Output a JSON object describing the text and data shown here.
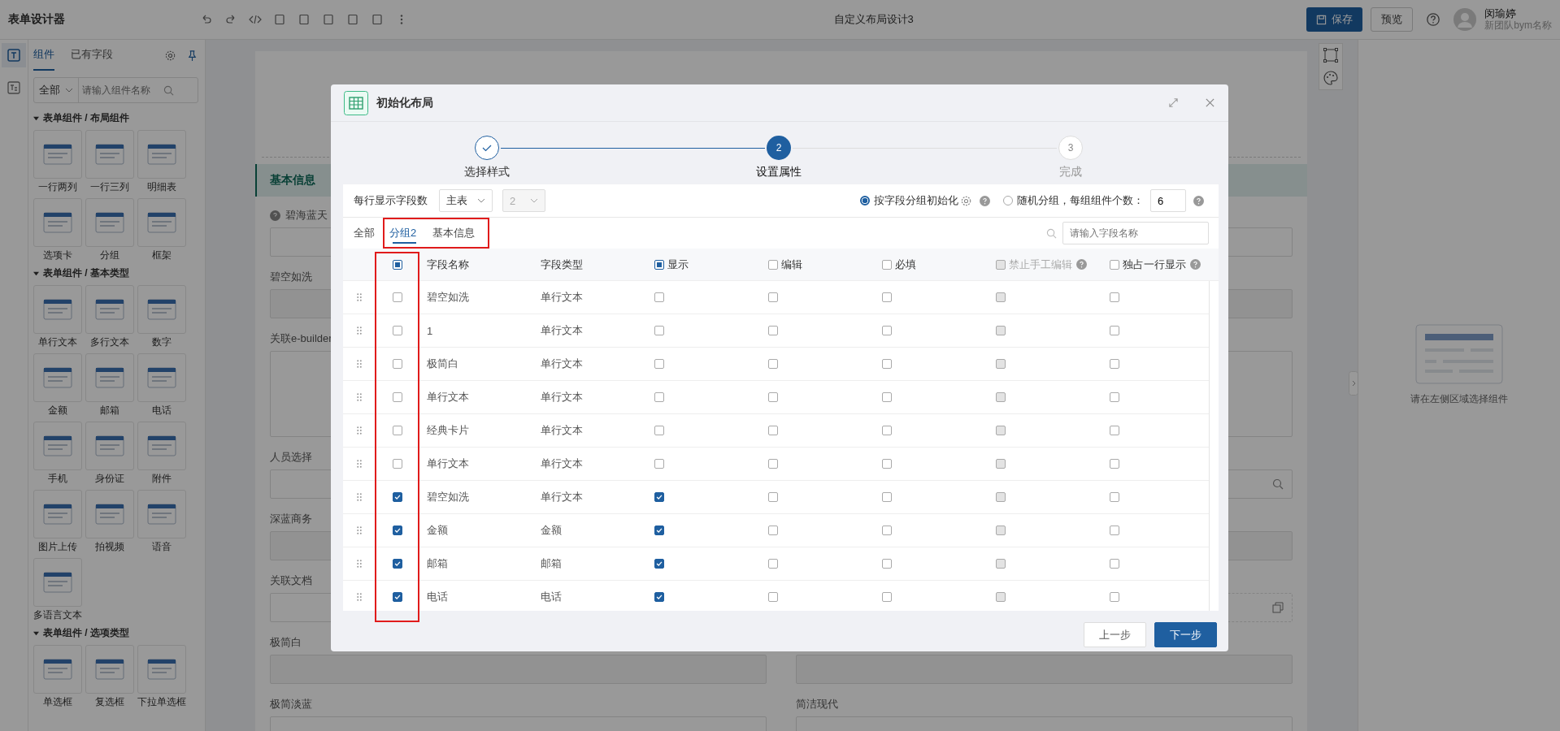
{
  "app": {
    "title": "表单设计器",
    "doc_title": "自定义布局设计3",
    "save": "保存",
    "preview": "预览",
    "user": {
      "name": "闵瑜婷",
      "team": "新团队bym名称"
    }
  },
  "panel": {
    "tabs": [
      {
        "label": "组件",
        "selected": true
      },
      {
        "label": "已有字段",
        "selected": false
      }
    ],
    "filter": "全部",
    "search_placeholder": "请输入组件名称",
    "groups": [
      {
        "title": "表单组件 / 布局组件",
        "items": [
          "一行两列",
          "一行三列",
          "明细表",
          "选项卡",
          "分组",
          "框架"
        ]
      },
      {
        "title": "表单组件 / 基本类型",
        "items": [
          "单行文本",
          "多行文本",
          "数字",
          "金额",
          "邮箱",
          "电话",
          "手机",
          "身份证",
          "附件",
          "图片上传",
          "拍视频",
          "语音",
          "多语言文本"
        ]
      },
      {
        "title": "表单组件 / 选项类型",
        "items": [
          "单选框",
          "复选框",
          "下拉单选框"
        ]
      }
    ]
  },
  "form": {
    "section": "基本信息",
    "fields": [
      {
        "label": "碧海蓝天",
        "help": true,
        "kind": "plain"
      },
      {
        "kind": "plain"
      },
      {
        "label": "碧空如洗",
        "kind": "filled"
      },
      {
        "kind": "filled"
      },
      {
        "label": "关联e-builder",
        "kind": "area"
      },
      {
        "kind": "area"
      },
      {
        "label": "人员选择",
        "kind": "plain"
      },
      {
        "kind": "search"
      },
      {
        "label": "深蓝商务",
        "kind": "filled"
      },
      {
        "kind": "filled"
      },
      {
        "label": "关联文档",
        "kind": "plain"
      },
      {
        "kind": "doc"
      },
      {
        "label": "极简白",
        "kind": "filled"
      },
      {
        "kind": "filled"
      },
      {
        "label": "极简淡蓝",
        "kind": "plain"
      },
      {
        "label": "简洁现代",
        "kind": "plain"
      }
    ]
  },
  "right_panel": {
    "hint": "请在左侧区域选择组件"
  },
  "dialog": {
    "title": "初始化布局",
    "steps": [
      {
        "label": "选择样式",
        "completed": true,
        "current": false
      },
      {
        "number": "2",
        "label": "设置属性",
        "completed": false,
        "current": true
      },
      {
        "number": "3",
        "label": "完成",
        "completed": false,
        "current": false
      }
    ],
    "per_row_label": "每行显示字段数",
    "table_select": "主表",
    "count_select": "2",
    "modes": [
      {
        "label": "按字段分组初始化",
        "selected": true,
        "kind": "gear"
      },
      {
        "label": "随机分组，每组组件个数：",
        "selected": false,
        "kind": "count"
      }
    ],
    "group_size": "6",
    "tabs": [
      {
        "label": "全部",
        "selected": false,
        "highlighted": false
      },
      {
        "label": "分组2",
        "selected": true,
        "highlighted": true
      },
      {
        "label": "基本信息",
        "selected": false,
        "highlighted": true
      }
    ],
    "search_placeholder": "请输入字段名称",
    "table": {
      "select_all": {
        "indeterminate": true
      },
      "select_highlighted": true,
      "columns": [
        {
          "kind": "text",
          "label": "字段名称"
        },
        {
          "kind": "text",
          "label": "字段类型"
        },
        {
          "kind": "check",
          "label": "显示",
          "indeterminate": true
        },
        {
          "kind": "check",
          "label": "编辑",
          "checked": false
        },
        {
          "kind": "check",
          "label": "必填",
          "checked": false
        },
        {
          "kind": "check",
          "label": "禁止手工编辑",
          "checked": false,
          "disabled": true,
          "help": true
        },
        {
          "kind": "check",
          "label": "独占一行显示",
          "checked": false,
          "help": true
        }
      ],
      "rows": [
        {
          "name": "碧空如洗",
          "type": "单行文本",
          "selected": false,
          "checks": [
            false,
            false,
            false,
            false,
            false
          ]
        },
        {
          "name": "1",
          "type": "单行文本",
          "selected": false,
          "checks": [
            false,
            false,
            false,
            false,
            false
          ]
        },
        {
          "name": "极简白",
          "type": "单行文本",
          "selected": false,
          "checks": [
            false,
            false,
            false,
            false,
            false
          ]
        },
        {
          "name": "单行文本",
          "type": "单行文本",
          "selected": false,
          "checks": [
            false,
            false,
            false,
            false,
            false
          ]
        },
        {
          "name": "经典卡片",
          "type": "单行文本",
          "selected": false,
          "checks": [
            false,
            false,
            false,
            false,
            false
          ]
        },
        {
          "name": "单行文本",
          "type": "单行文本",
          "selected": false,
          "checks": [
            false,
            false,
            false,
            false,
            false
          ]
        },
        {
          "name": "碧空如洗",
          "type": "单行文本",
          "selected": true,
          "checks": [
            true,
            false,
            false,
            false,
            false
          ]
        },
        {
          "name": "金额",
          "type": "金额",
          "selected": true,
          "checks": [
            true,
            false,
            false,
            false,
            false
          ]
        },
        {
          "name": "邮箱",
          "type": "邮箱",
          "selected": true,
          "checks": [
            true,
            false,
            false,
            false,
            false
          ]
        },
        {
          "name": "电话",
          "type": "电话",
          "selected": true,
          "checks": [
            true,
            false,
            false,
            false,
            false
          ]
        }
      ]
    },
    "buttons": [
      {
        "label": "上一步",
        "kind": "secondary"
      },
      {
        "label": "下一步",
        "kind": "primary"
      }
    ]
  }
}
